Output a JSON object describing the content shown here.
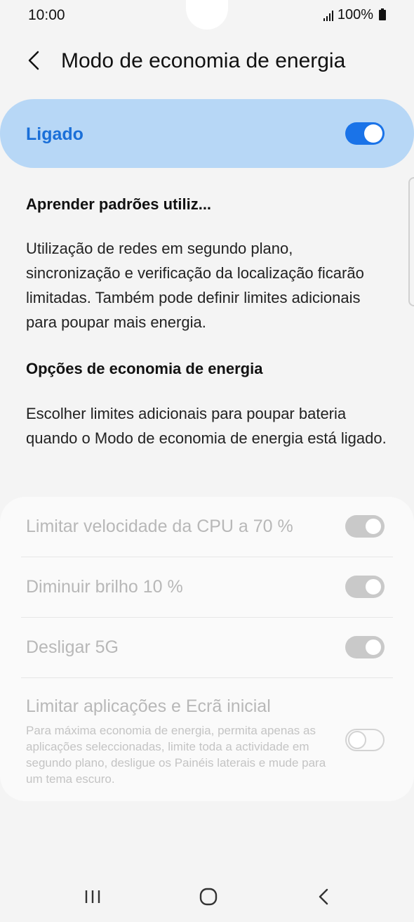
{
  "status_bar": {
    "time": "10:00",
    "battery": "100%",
    "icons": [
      "signal-icon",
      "battery-icon"
    ]
  },
  "header": {
    "title": "Modo de economia de energia",
    "back_icon": "chevron-left-icon"
  },
  "master_switch": {
    "label": "Ligado",
    "state": "on",
    "accent_color": "#1a73e8",
    "card_color": "#b7d7f6"
  },
  "sections": [
    {
      "title": "Aprender padrões utiliz...",
      "description": "Utilização de redes em segundo plano, sincronização e verificação da localização ficarão limitadas. Também pode definir limites adicionais para poupar mais energia."
    },
    {
      "title": "Opções de economia de energia",
      "description": "Escolher limites adicionais para poupar bateria quando o Modo de economia de energia está ligado."
    }
  ],
  "options": [
    {
      "label": "Limitar velocidade da CPU a 70 %",
      "state": "on",
      "enabled": false
    },
    {
      "label": "Diminuir brilho 10 %",
      "state": "on",
      "enabled": false
    },
    {
      "label": "Desligar 5G",
      "state": "on",
      "enabled": false
    },
    {
      "label": "Limitar aplicações e Ecrã inicial",
      "description": "Para máxima economia de energia, permita apenas as aplicações seleccionadas, limite toda a actividade em segundo plano, desligue os Painéis laterais e mude para um tema escuro.",
      "state": "off",
      "enabled": false
    }
  ],
  "nav_bar": {
    "items": [
      "recent-apps-icon",
      "home-icon",
      "back-icon"
    ]
  }
}
